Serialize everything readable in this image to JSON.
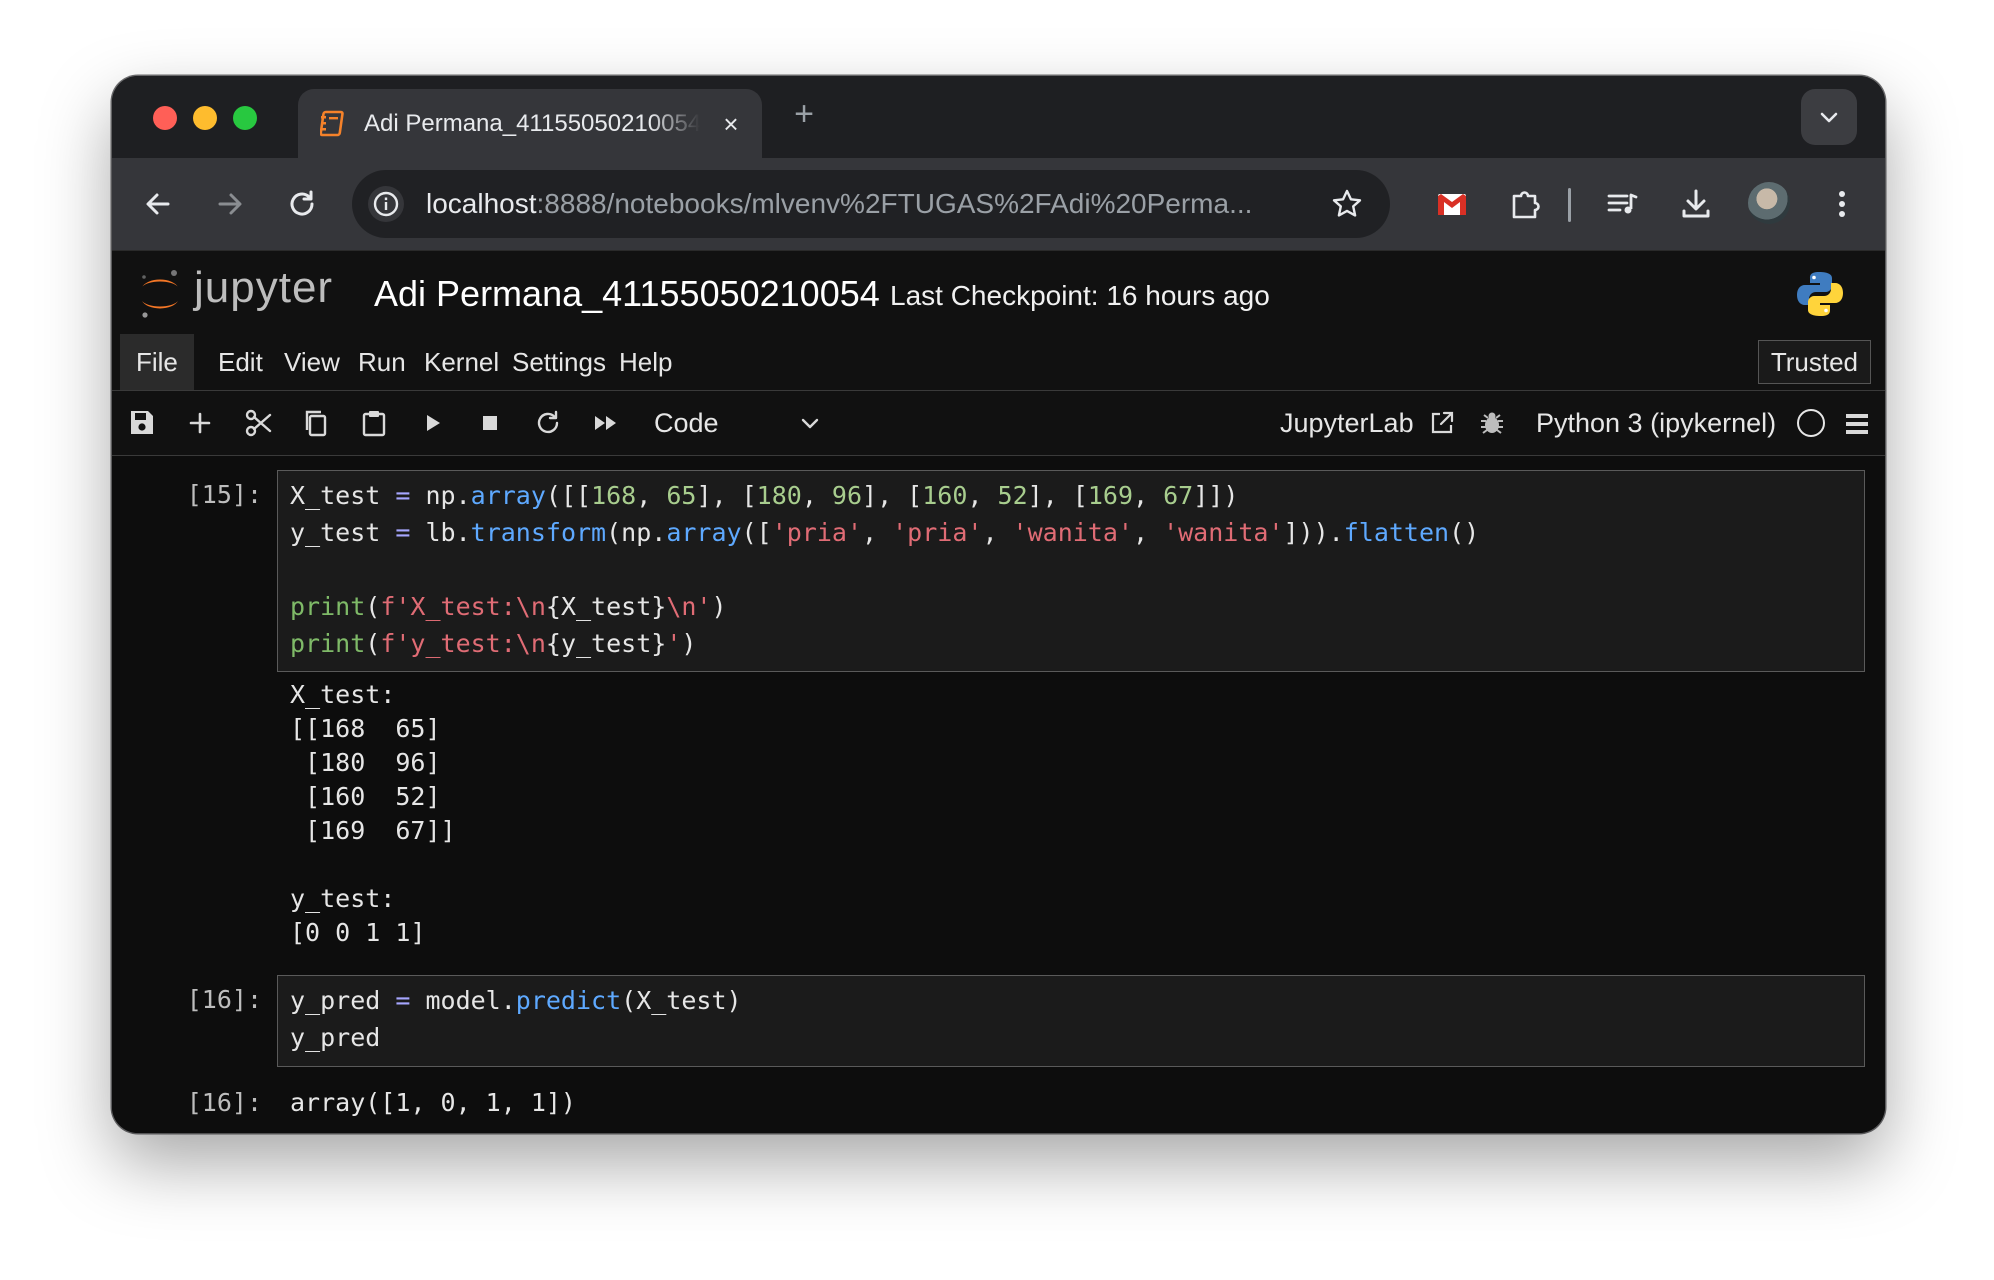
{
  "browser": {
    "tab_title": "Adi Permana_41155050210054",
    "new_tab_label": "+",
    "close_label": "×",
    "url_host": "localhost",
    "url_path": ":8888/notebooks/mlvenv%2FTUGAS%2FAdi%20Perma..."
  },
  "jupyter": {
    "wordmark": "jupyter",
    "notebook_title": "Adi Permana_41155050210054",
    "checkpoint": "Last Checkpoint: 16 hours ago",
    "menu": [
      "File",
      "Edit",
      "View",
      "Run",
      "Kernel",
      "Settings",
      "Help"
    ],
    "trusted": "Trusted",
    "cell_type": "Code",
    "jupyterlab_link": "JupyterLab",
    "kernel_name": "Python 3 (ipykernel)"
  },
  "cells": {
    "c15_prompt": "[15]:",
    "c15_out_xlabel": "X_test:",
    "c15_out_x": "[[168  65]\n [180  96]\n [160  52]\n [169  67]]",
    "c15_out_ylabel": "y_test:",
    "c15_out_y": "[0 0 1 1]",
    "c16_prompt": "[16]:",
    "c16_out_prompt": "[16]:",
    "c16_out": "array([1, 0, 1, 1])"
  },
  "colors": {
    "operator": "#a6a6ff",
    "function": "#5ea9ff",
    "builtin": "#7fba68",
    "number": "#a8cd8e",
    "string": "#e06c75"
  }
}
